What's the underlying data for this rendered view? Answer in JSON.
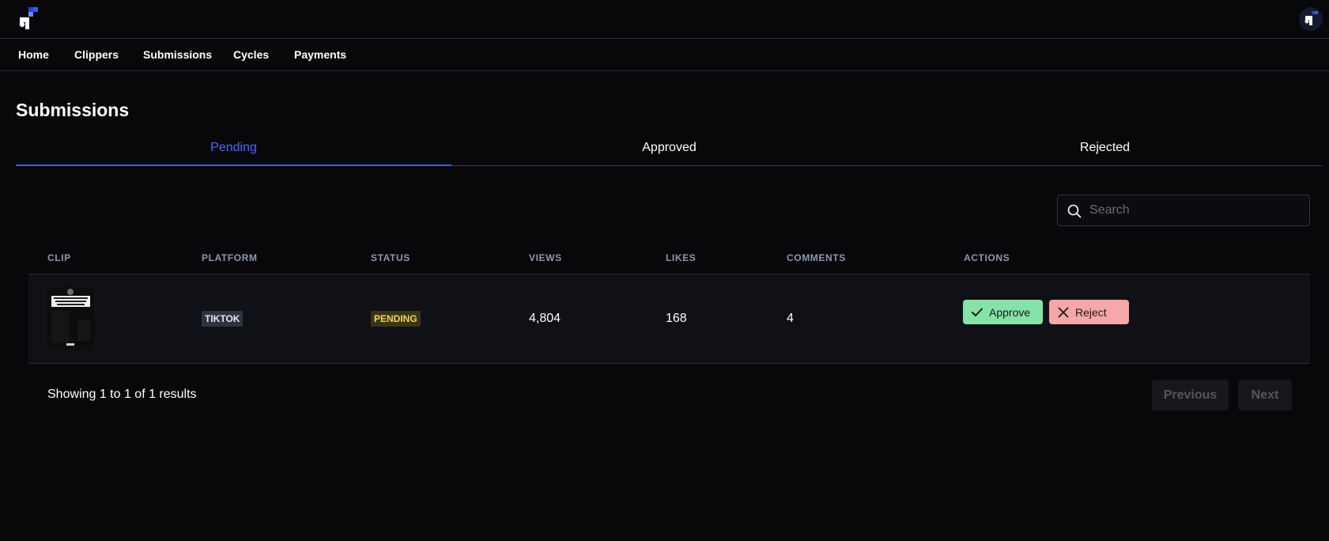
{
  "nav": {
    "items": [
      "Home",
      "Clippers",
      "Submissions",
      "Cycles",
      "Payments"
    ]
  },
  "page": {
    "title": "Submissions"
  },
  "tabs": [
    {
      "label": "Pending",
      "active": true
    },
    {
      "label": "Approved",
      "active": false
    },
    {
      "label": "Rejected",
      "active": false
    }
  ],
  "search": {
    "placeholder": "Search",
    "value": ""
  },
  "table": {
    "columns": [
      "CLIP",
      "PLATFORM",
      "STATUS",
      "VIEWS",
      "LIKES",
      "COMMENTS",
      "ACTIONS"
    ],
    "rows": [
      {
        "platform": "TIKTOK",
        "status": "PENDING",
        "views": "4,804",
        "likes": "168",
        "comments": "4",
        "actions": {
          "approve": "Approve",
          "reject": "Reject"
        }
      }
    ]
  },
  "pagination": {
    "summary": "Showing 1 to 1 of 1 results",
    "previous": "Previous",
    "next": "Next"
  },
  "colors": {
    "background": "#08080b",
    "accent": "#3d5cf5",
    "approve": "#86e3a8",
    "reject": "#f7a7a7",
    "pending": "#f4d35e"
  },
  "icons": {
    "logo": "app-logo-icon",
    "avatar": "user-avatar-icon",
    "search": "search-icon",
    "approve": "check-icon",
    "reject": "close-icon"
  }
}
